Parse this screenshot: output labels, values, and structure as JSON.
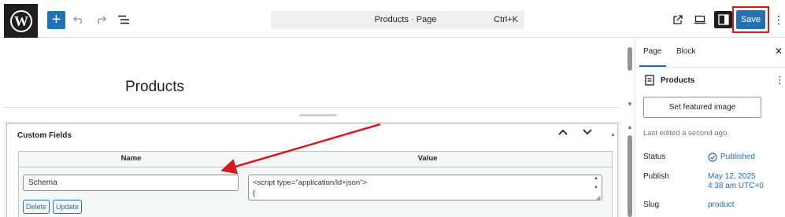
{
  "toolbar": {
    "wp_logo_glyph": "W",
    "add_block_glyph": "+",
    "document_title": "Products · Page",
    "shortcut": "Ctrl+K",
    "save_label": "Save",
    "more_glyph": "⋮"
  },
  "editor": {
    "page_title": "Products"
  },
  "custom_fields": {
    "title": "Custom Fields",
    "columns": {
      "name": "Name",
      "value": "Value"
    },
    "field": {
      "name": "Schema",
      "value_line1": "<script type=\"application/ld+json\">",
      "value_line2": "{"
    },
    "delete_label": "Delete",
    "update_label": "Update"
  },
  "sidebar": {
    "tabs": {
      "page": "Page",
      "block": "Block"
    },
    "close_glyph": "✕",
    "doc_title": "Products",
    "doc_more_glyph": "⋮",
    "featured_image_label": "Set featured image",
    "last_edited": "Last edited a second ago.",
    "status_label": "Status",
    "status_value": "Published",
    "publish_label": "Publish",
    "publish_date": "May 12, 2025",
    "publish_time": "4:38 am UTC+0",
    "slug_label": "Slug",
    "slug_value": "product"
  },
  "colors": {
    "accent": "#2271b1",
    "annotation": "#d9191c"
  },
  "icons": [
    "wordpress-icon",
    "undo-icon",
    "redo-icon",
    "list-view-icon",
    "external-link-icon",
    "preview-icon",
    "sidebar-toggle-icon",
    "document-icon",
    "published-check-icon"
  ]
}
